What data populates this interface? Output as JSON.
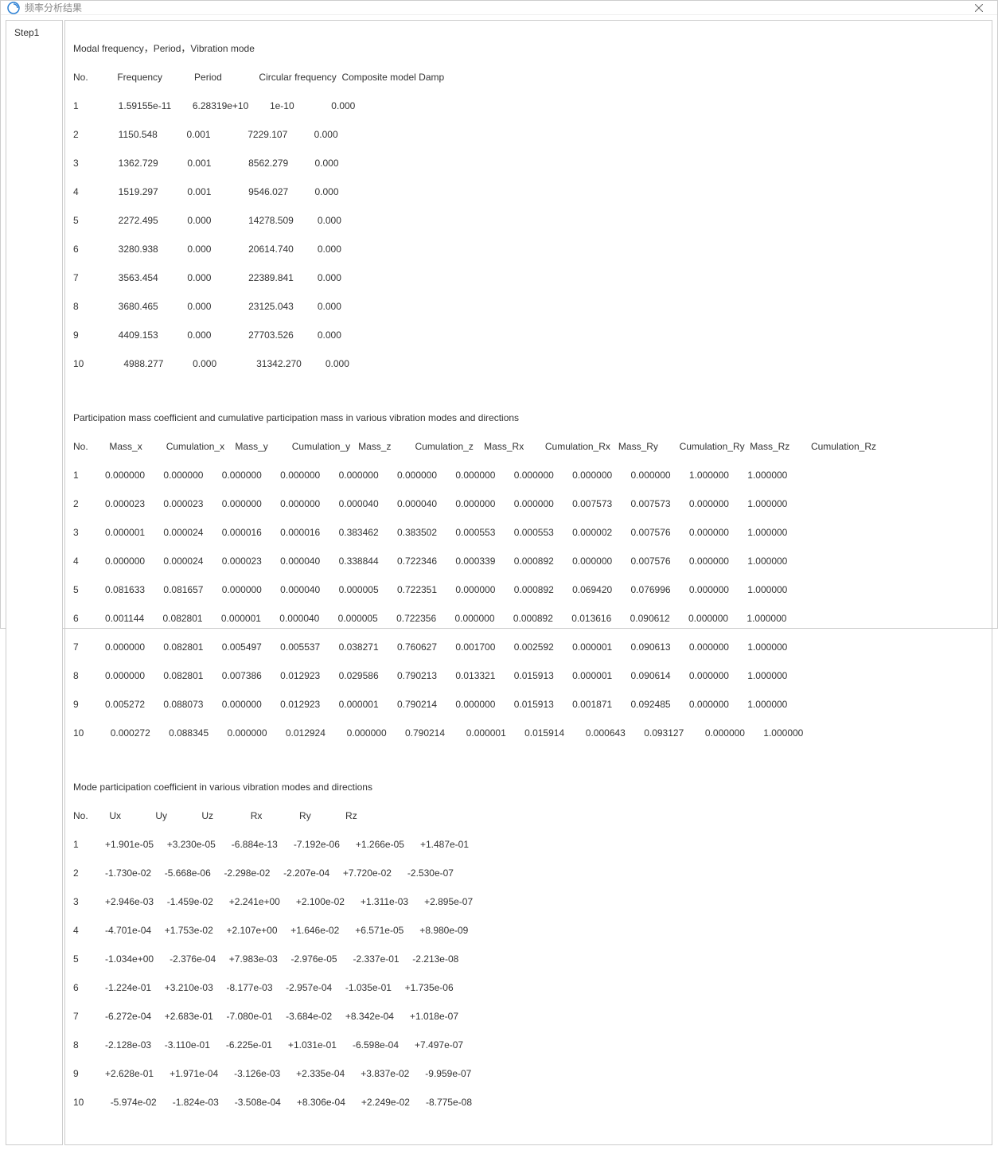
{
  "window": {
    "title": "频率分析结果"
  },
  "sidebar": {
    "tabs": [
      {
        "label": "Step1",
        "active": true
      }
    ]
  },
  "sections": {
    "modal": {
      "title": "Modal frequency，Period，Vibration mode",
      "header": "No.           Frequency            Period              Circular frequency  Composite model Damp",
      "rows": [
        "1               1.59155e-11        6.28319e+10        1e-10              0.000",
        "2               1150.548           0.001              7229.107          0.000",
        "3               1362.729           0.001              8562.279          0.000",
        "4               1519.297           0.001              9546.027          0.000",
        "5               2272.495           0.000              14278.509         0.000",
        "6               3280.938           0.000              20614.740         0.000",
        "7               3563.454           0.000              22389.841         0.000",
        "8               3680.465           0.000              23125.043         0.000",
        "9               4409.153           0.000              27703.526         0.000",
        "10               4988.277           0.000               31342.270         0.000"
      ]
    },
    "participation": {
      "title": "Participation mass coefficient and cumulative participation mass in various vibration modes and directions",
      "header": "No.        Mass_x         Cumulation_x    Mass_y         Cumulation_y   Mass_z         Cumulation_z    Mass_Rx        Cumulation_Rx   Mass_Ry        Cumulation_Ry  Mass_Rz        Cumulation_Rz",
      "rows": [
        "1          0.000000       0.000000       0.000000       0.000000       0.000000       0.000000       0.000000       0.000000       0.000000       0.000000       1.000000       1.000000",
        "2          0.000023       0.000023       0.000000       0.000000       0.000040       0.000040       0.000000       0.000000       0.007573       0.007573       0.000000       1.000000",
        "3          0.000001       0.000024       0.000016       0.000016       0.383462       0.383502       0.000553       0.000553       0.000002       0.007576       0.000000       1.000000",
        "4          0.000000       0.000024       0.000023       0.000040       0.338844       0.722346       0.000339       0.000892       0.000000       0.007576       0.000000       1.000000",
        "5          0.081633       0.081657       0.000000       0.000040       0.000005       0.722351       0.000000       0.000892       0.069420       0.076996       0.000000       1.000000",
        "6          0.001144       0.082801       0.000001       0.000040       0.000005       0.722356       0.000000       0.000892       0.013616       0.090612       0.000000       1.000000",
        "7          0.000000       0.082801       0.005497       0.005537       0.038271       0.760627       0.001700       0.002592       0.000001       0.090613       0.000000       1.000000",
        "8          0.000000       0.082801       0.007386       0.012923       0.029586       0.790213       0.013321       0.015913       0.000001       0.090614       0.000000       1.000000",
        "9          0.005272       0.088073       0.000000       0.012923       0.000001       0.790214       0.000000       0.015913       0.001871       0.092485       0.000000       1.000000",
        "10          0.000272       0.088345       0.000000       0.012924        0.000000       0.790214        0.000001       0.015914        0.000643       0.093127        0.000000       1.000000"
      ]
    },
    "modepart": {
      "title": "Mode participation coefficient in various vibration modes and directions",
      "header": "No.        Ux             Uy             Uz              Rx              Ry             Rz",
      "rows": [
        "1          +1.901e-05     +3.230e-05      -6.884e-13      -7.192e-06      +1.266e-05      +1.487e-01",
        "2          -1.730e-02     -5.668e-06     -2.298e-02     -2.207e-04     +7.720e-02      -2.530e-07",
        "3          +2.946e-03     -1.459e-02      +2.241e+00      +2.100e-02      +1.311e-03      +2.895e-07",
        "4          -4.701e-04     +1.753e-02     +2.107e+00     +1.646e-02      +6.571e-05      +8.980e-09",
        "5          -1.034e+00      -2.376e-04     +7.983e-03     -2.976e-05      -2.337e-01     -2.213e-08",
        "6          -1.224e-01     +3.210e-03     -8.177e-03     -2.957e-04     -1.035e-01     +1.735e-06",
        "7          -6.272e-04     +2.683e-01     -7.080e-01     -3.684e-02     +8.342e-04      +1.018e-07",
        "8          -2.128e-03     -3.110e-01      -6.225e-01      +1.031e-01      -6.598e-04      +7.497e-07",
        "9          +2.628e-01      +1.971e-04      -3.126e-03      +2.335e-04      +3.837e-02      -9.959e-07",
        "10          -5.974e-02      -1.824e-03      -3.508e-04      +8.306e-04      +2.249e-02      -8.775e-08"
      ]
    }
  }
}
